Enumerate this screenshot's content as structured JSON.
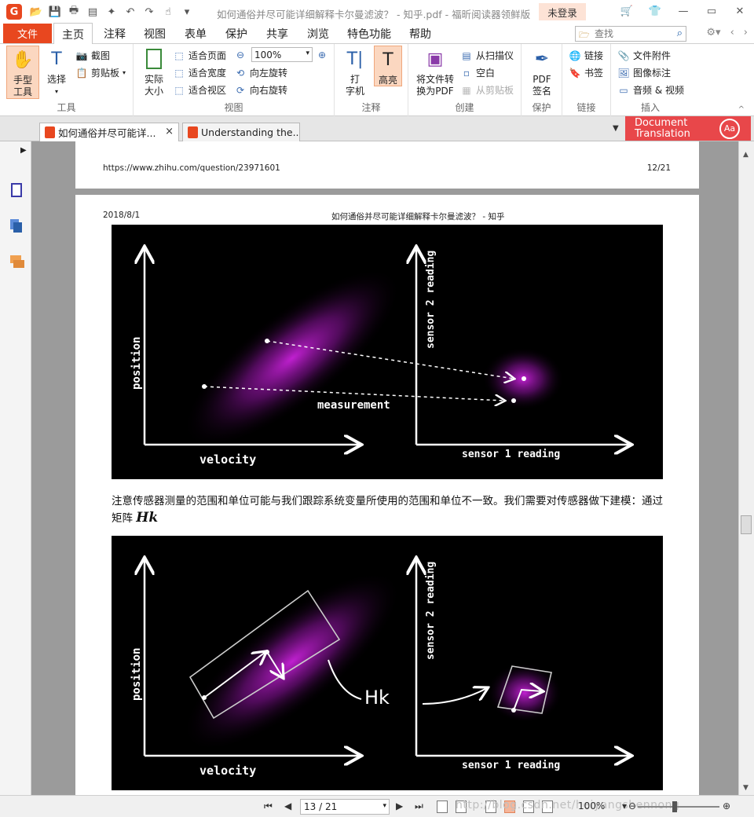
{
  "window": {
    "title": "如何通俗并尽可能详细解释卡尔曼滤波？ - 知乎.pdf - 福昕阅读器领鲜版",
    "login": "未登录"
  },
  "menu": {
    "file": "文件",
    "items": [
      "主页",
      "注释",
      "视图",
      "表单",
      "保护",
      "共享",
      "浏览",
      "特色功能",
      "帮助"
    ],
    "search_placeholder": "查找"
  },
  "ribbon": {
    "tools": {
      "hand": "手型\n工具",
      "select": "选择",
      "screenshot": "截图",
      "clipboard": "剪贴板",
      "label": "工具"
    },
    "view": {
      "actual_size": "实际\n大小",
      "fit_page": "适合页面",
      "fit_width": "适合宽度",
      "fit_view": "适合视区",
      "zoom_value": "100%",
      "rotate_left": "向左旋转",
      "rotate_right": "向右旋转",
      "label": "视图"
    },
    "comment": {
      "typewriter": "打\n字机",
      "highlight": "高亮",
      "label": "注释"
    },
    "create": {
      "convert": "将文件转\n换为PDF",
      "from_scanner": "从扫描仪",
      "blank": "空白",
      "from_clipboard": "从剪贴板",
      "label": "创建"
    },
    "protect": {
      "sign": "PDF\n签名",
      "label": "保护"
    },
    "links": {
      "link": "链接",
      "bookmark": "书签",
      "label": "链接"
    },
    "insert": {
      "attachment": "文件附件",
      "image": "图像标注",
      "audio_video": "音频 & 视频",
      "label": "插入"
    }
  },
  "tabs": [
    {
      "label": "如何通俗并尽可能详..."
    },
    {
      "label": "Understanding the..."
    }
  ],
  "translate": {
    "line1": "Document",
    "line2": "Translation",
    "badge": "Aa"
  },
  "page1": {
    "url": "https://www.zhihu.com/question/23971601",
    "page_num": "12/21"
  },
  "page2": {
    "date": "2018/8/1",
    "header_title": "如何通俗并尽可能详细解释卡尔曼滤波？ - 知乎",
    "paragraph": "注意传感器测量的范围和单位可能与我们跟踪系统变量所使用的范围和单位不一致。我们需要对传感器做下建模：通过矩阵",
    "math": "Hk"
  },
  "figure1": {
    "y_label": "position",
    "x_label": "velocity",
    "annotation": "measurement",
    "y_label_right": "sensor 2 reading",
    "x_label_right": "sensor 1 reading"
  },
  "figure2": {
    "y_label": "position",
    "x_label": "velocity",
    "transform_label": "Hk",
    "y_label_right": "sensor 2 reading",
    "x_label_right": "sensor 1 reading"
  },
  "status": {
    "page_field": "13 / 21",
    "zoom": "100%",
    "watermark": "http://blog.csdn.net/heiyangshennong"
  },
  "colors": {
    "accent": "#e8471f",
    "glow": "#b020c0",
    "translate_bg": "#e8474a"
  }
}
